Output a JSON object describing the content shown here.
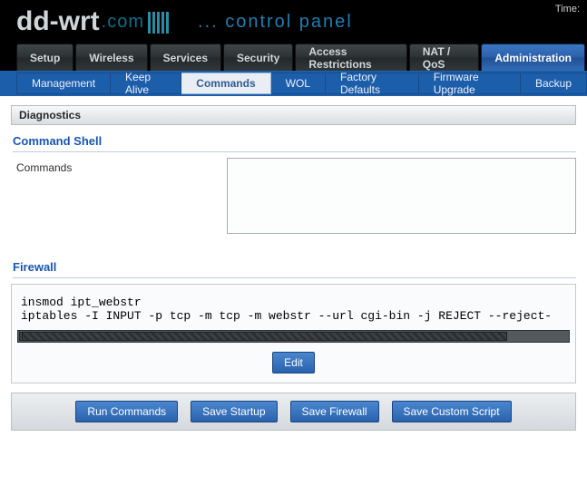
{
  "header": {
    "logo_prefix": "dd-wrt",
    "logo_suffix": ".com",
    "control_panel_label": "... control panel",
    "time_label": "Time:"
  },
  "topnav": {
    "items": [
      {
        "label": "Setup",
        "active": false
      },
      {
        "label": "Wireless",
        "active": false
      },
      {
        "label": "Services",
        "active": false
      },
      {
        "label": "Security",
        "active": false
      },
      {
        "label": "Access Restrictions",
        "active": false
      },
      {
        "label": "NAT / QoS",
        "active": false
      },
      {
        "label": "Administration",
        "active": true
      }
    ]
  },
  "subnav": {
    "items": [
      {
        "label": "Management",
        "active": false
      },
      {
        "label": "Keep Alive",
        "active": false
      },
      {
        "label": "Commands",
        "active": true
      },
      {
        "label": "WOL",
        "active": false
      },
      {
        "label": "Factory Defaults",
        "active": false
      },
      {
        "label": "Firmware Upgrade",
        "active": false
      },
      {
        "label": "Backup",
        "active": false
      }
    ]
  },
  "page": {
    "title": "Diagnostics",
    "command_shell": {
      "group_label": "Command Shell",
      "field_label": "Commands",
      "value": ""
    },
    "firewall": {
      "group_label": "Firewall",
      "script": "insmod ipt_webstr\niptables -I INPUT -p tcp -m tcp -m webstr --url cgi-bin -j REJECT --reject-",
      "edit_label": "Edit"
    },
    "actions": {
      "run": "Run Commands",
      "save_startup": "Save Startup",
      "save_firewall": "Save Firewall",
      "save_custom": "Save Custom Script"
    }
  }
}
